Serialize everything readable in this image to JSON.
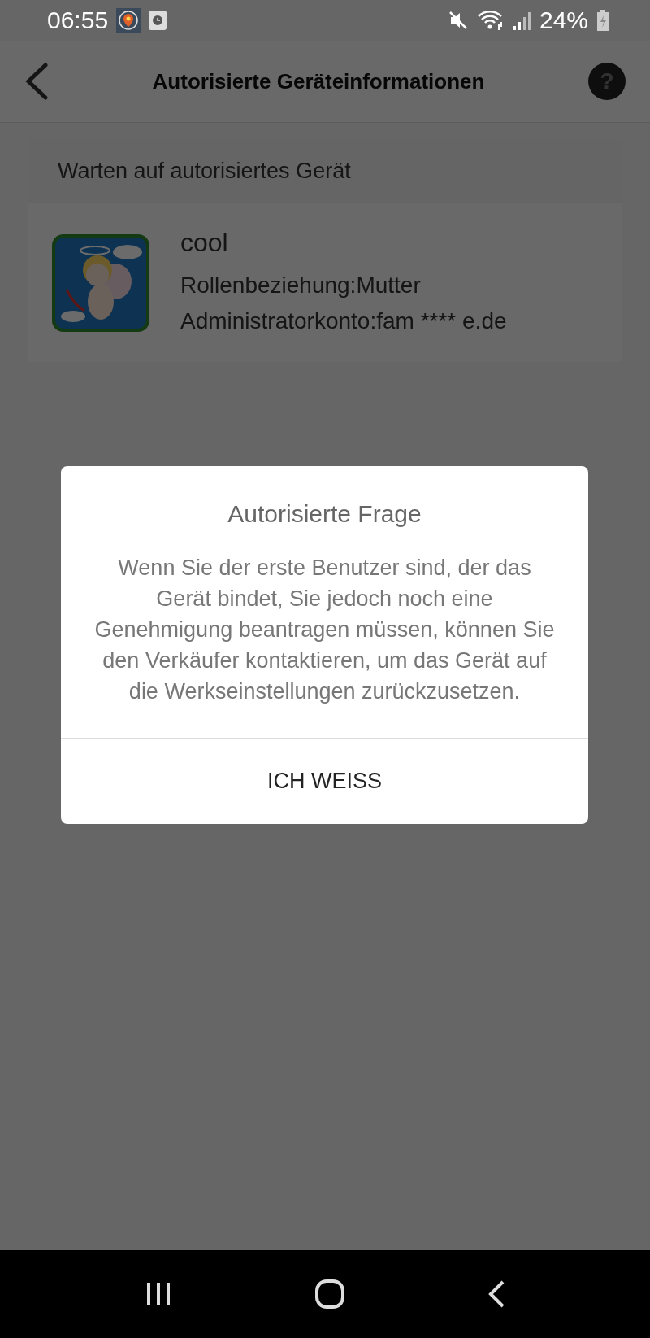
{
  "status_bar": {
    "time": "06:55",
    "battery": "24%"
  },
  "header": {
    "title": "Autorisierte Geräteinformationen",
    "help": "?"
  },
  "section": {
    "title": "Warten auf autorisiertes Gerät"
  },
  "devices": [
    {
      "name": "cool",
      "lines": [
        "Rollenbeziehung:Mutter",
        "Administratorkonto:fam **** e.de"
      ]
    }
  ],
  "dialog": {
    "title": "Autorisierte Frage",
    "message": "Wenn Sie der erste Benutzer sind, der das Gerät bindet, Sie jedoch noch eine Genehmigung beantragen müssen, können Sie den Verkäufer kontaktieren, um das Gerät auf die Werkseinstellungen zurückzusetzen.",
    "button": "ICH WEISS"
  }
}
